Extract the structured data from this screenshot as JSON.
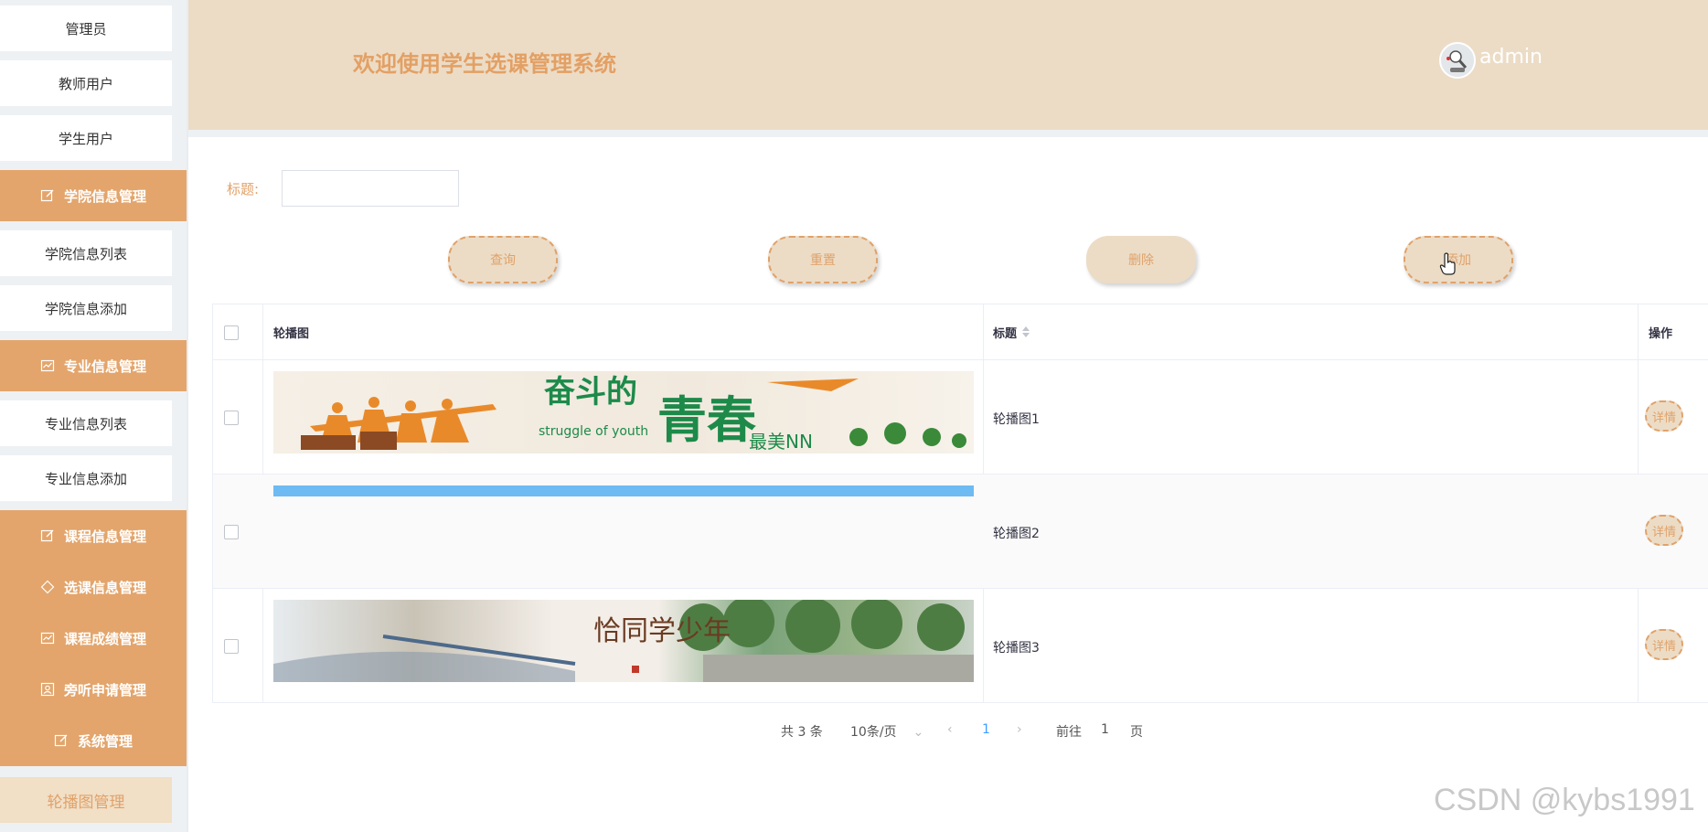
{
  "sidebar": {
    "items": [
      {
        "label": "管理员"
      },
      {
        "label": "教师用户"
      },
      {
        "label": "学生用户"
      },
      {
        "label": "学院信息管理"
      },
      {
        "label": "学院信息列表"
      },
      {
        "label": "学院信息添加"
      },
      {
        "label": "专业信息管理"
      },
      {
        "label": "专业信息列表"
      },
      {
        "label": "专业信息添加"
      },
      {
        "label": "课程信息管理"
      },
      {
        "label": "选课信息管理"
      },
      {
        "label": "课程成绩管理"
      },
      {
        "label": "旁听申请管理"
      },
      {
        "label": "系统管理"
      },
      {
        "label": "轮播图管理"
      }
    ]
  },
  "header": {
    "title": "欢迎使用学生选课管理系统",
    "username": "admin"
  },
  "search": {
    "title_label": "标题:",
    "title_value": ""
  },
  "toolbar": {
    "query": "查询",
    "reset": "重置",
    "delete": "删除",
    "add": "添加"
  },
  "table": {
    "columns": [
      "轮播图",
      "标题",
      "操作"
    ],
    "rows": [
      {
        "title": "轮播图1",
        "action": "详情"
      },
      {
        "title": "轮播图2",
        "action": "详情"
      },
      {
        "title": "轮播图3",
        "action": "详情"
      }
    ],
    "banner1_text": {
      "line1": "奋斗的",
      "line2": "青春",
      "line3": "最美NN",
      "en": "struggle of youth"
    },
    "banner3_text": {
      "line1": "恰同学少年"
    }
  },
  "pagination": {
    "total": "共 3 条",
    "page_size": "10条/页",
    "current": "1",
    "goto_label": "前往",
    "goto_value": "1",
    "page_unit": "页"
  },
  "watermark": "CSDN @kybs1991",
  "colors": {
    "accent": "#e3a56c",
    "header_bg": "#ecdcc6",
    "active_link": "#409eff"
  }
}
